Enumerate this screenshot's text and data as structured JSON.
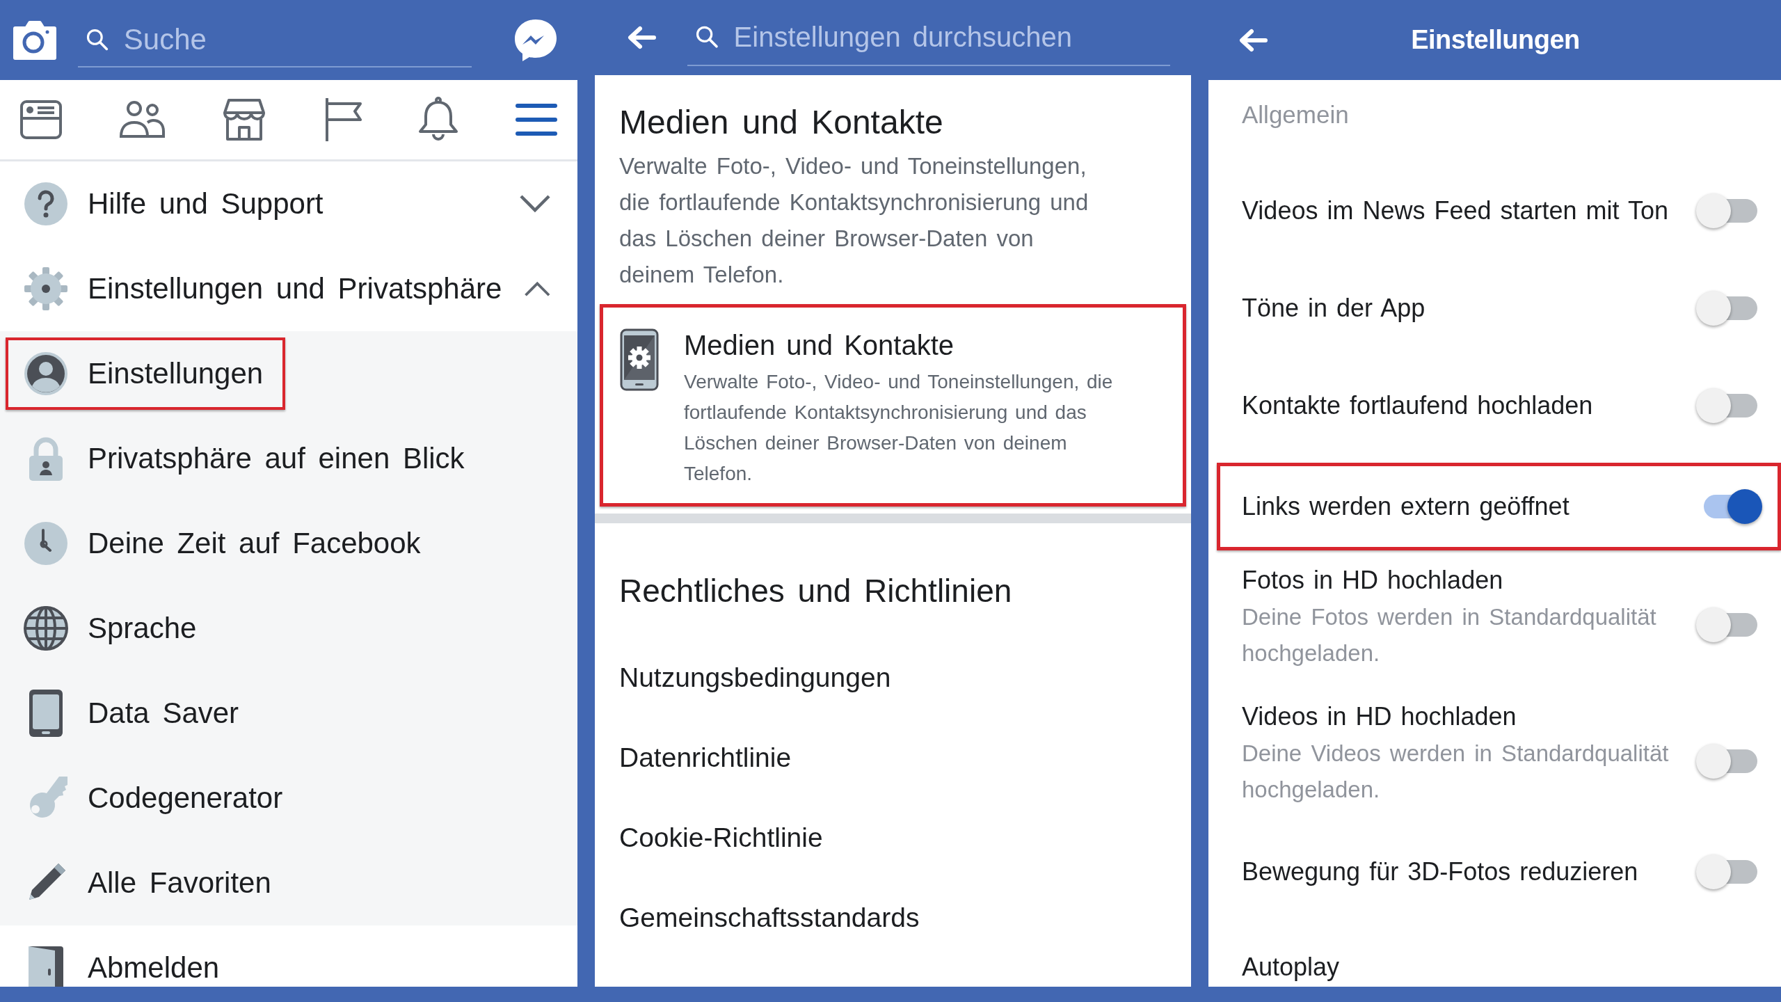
{
  "left": {
    "search": {
      "placeholder": "Suche"
    },
    "tabs": [
      {
        "selected": false
      },
      {
        "selected": false
      },
      {
        "selected": false
      },
      {
        "selected": false
      },
      {
        "selected": false
      },
      {
        "selected": true
      }
    ],
    "menu": [
      {
        "label": "Hilfe und Support",
        "expanded": false
      },
      {
        "label": "Einstellungen und Privatsphäre",
        "expanded": true,
        "children": [
          {
            "label": "Einstellungen",
            "highlighted": true
          },
          {
            "label": "Privatsphäre auf einen Blick",
            "highlighted": false
          },
          {
            "label": "Deine Zeit auf Facebook",
            "highlighted": false
          },
          {
            "label": "Sprache",
            "highlighted": false
          },
          {
            "label": "Data Saver",
            "highlighted": false
          },
          {
            "label": "Codegenerator",
            "highlighted": false
          },
          {
            "label": "Alle Favoriten",
            "highlighted": false
          }
        ]
      },
      {
        "label": "Abmelden"
      }
    ]
  },
  "middle": {
    "search": {
      "placeholder": "Einstellungen durchsuchen"
    },
    "title": "Medien und Kontakte",
    "description": "Verwalte Foto-, Video- und Toneinstellungen, die fortlaufende Kontaktsynchronisierung und das Löschen deiner Browser-Daten von deinem Telefon.",
    "card": {
      "title": "Medien und Kontakte",
      "description": "Verwalte Foto-, Video- und Toneinstellungen, die fortlaufende Kontaktsynchronisierung und das Löschen deiner Browser-Daten von deinem Telefon.",
      "highlighted": true
    },
    "section_title": "Rechtliches und Richtlinien",
    "links": [
      "Nutzungsbedingungen",
      "Datenrichtlinie",
      "Cookie-Richtlinie",
      "Gemeinschaftsstandards"
    ]
  },
  "right": {
    "title": "Einstellungen",
    "section": "Allgemein",
    "settings": [
      {
        "label": "Videos im News Feed starten mit Ton",
        "on": false,
        "highlighted": false
      },
      {
        "label": "Töne in der App",
        "on": false,
        "highlighted": false
      },
      {
        "label": "Kontakte fortlaufend hochladen",
        "on": false,
        "highlighted": false
      },
      {
        "label": "Links werden extern geöffnet",
        "on": true,
        "highlighted": true
      },
      {
        "label": "Fotos in HD hochladen",
        "description": "Deine Fotos werden in Standardqualität hochgeladen.",
        "on": false,
        "highlighted": false
      },
      {
        "label": "Videos in HD hochladen",
        "description": "Deine Videos werden in Standardqualität hochgeladen.",
        "on": false,
        "highlighted": false
      },
      {
        "label": "Bewegung für 3D-Fotos reduzieren",
        "on": false,
        "highlighted": false
      }
    ],
    "next_section": "Autoplay"
  }
}
